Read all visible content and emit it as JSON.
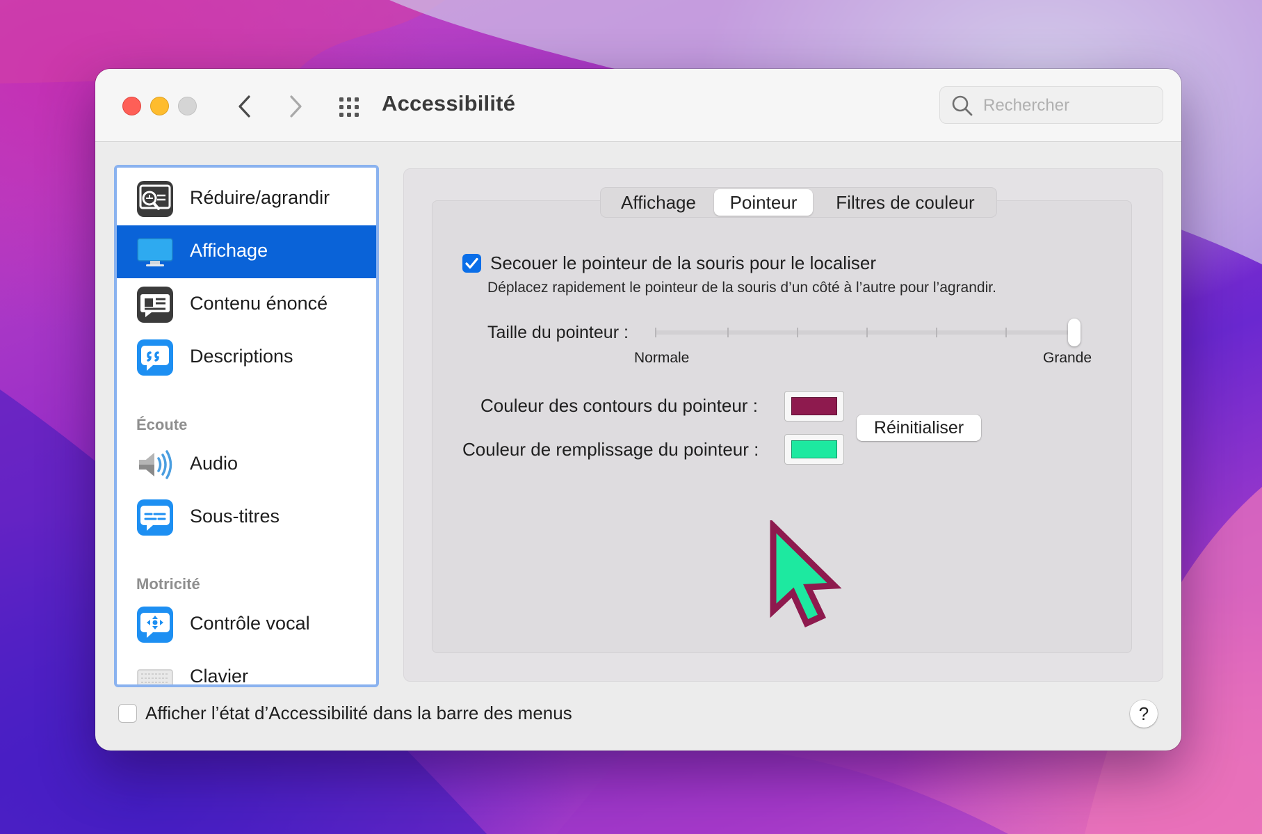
{
  "window": {
    "title": "Accessibilité"
  },
  "search": {
    "placeholder": "Rechercher"
  },
  "icons": {
    "back": "chevron-left-icon",
    "forward": "chevron-right-icon",
    "show_all": "grid-icon",
    "search": "search-icon",
    "cursor_preview": "pointer-arrow-icon"
  },
  "sidebar": {
    "items": [
      {
        "label": "Réduire/agrandir",
        "icon": "zoom-icon"
      },
      {
        "label": "Affichage",
        "icon": "display-icon",
        "selected": true
      },
      {
        "label": "Contenu énoncé",
        "icon": "spoken-content-icon"
      },
      {
        "label": "Descriptions",
        "icon": "descriptions-icon"
      },
      {
        "label": "Audio",
        "icon": "speaker-icon"
      },
      {
        "label": "Sous-titres",
        "icon": "subtitles-icon"
      },
      {
        "label": "Contrôle vocal",
        "icon": "voice-control-icon"
      },
      {
        "label": "Clavier",
        "icon": "keyboard-icon"
      }
    ],
    "sections": [
      "Écoute",
      "Motricité"
    ]
  },
  "tabs": [
    {
      "label": "Affichage"
    },
    {
      "label": "Pointeur",
      "active": true
    },
    {
      "label": "Filtres de couleur"
    }
  ],
  "pointer": {
    "shake_label": "Secouer le pointeur de la souris pour le localiser",
    "shake_checked": true,
    "shake_desc": "Déplacez rapidement le pointeur de la souris d’un côté à l’autre pour l’agrandir.",
    "size_label": "Taille du pointeur :",
    "size_min_label": "Normale",
    "size_max_label": "Grande",
    "size_value": 1.0,
    "outline_label": "Couleur des contours du pointeur :",
    "outline_color": "#8e1a4e",
    "fill_label": "Couleur de remplissage du pointeur :",
    "fill_color": "#1de9a0",
    "reset_label": "Réinitialiser"
  },
  "footer": {
    "menu_status_label": "Afficher l’état d’Accessibilité dans la barre des menus",
    "menu_status_checked": false,
    "help_label": "?"
  },
  "colors": {
    "accent": "#0a63d8",
    "sidebar_focus_ring": "#8ab2ef"
  }
}
